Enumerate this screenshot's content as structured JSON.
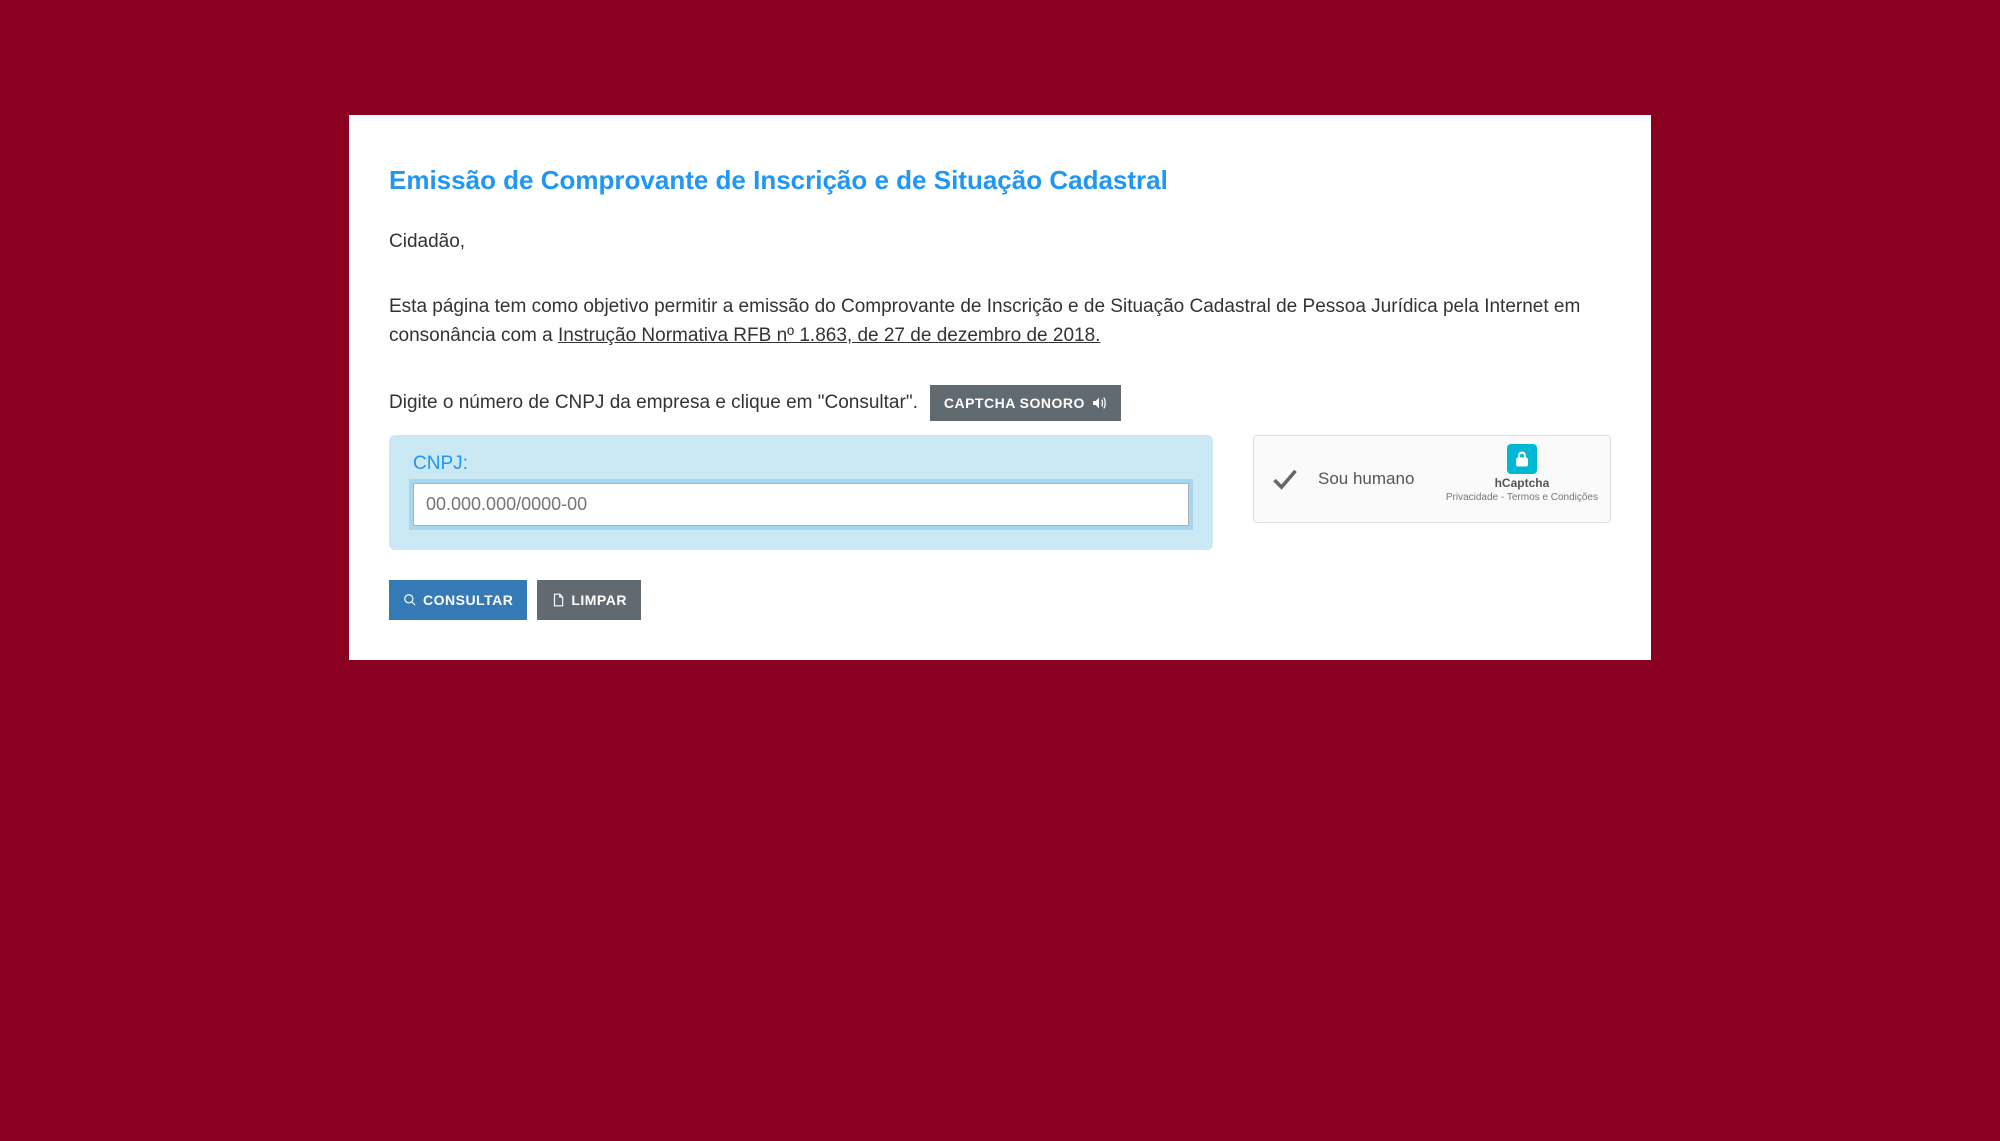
{
  "page": {
    "title": "Emissão de Comprovante de Inscrição e de Situação Cadastral",
    "greeting": "Cidadão,",
    "description_prefix": "Esta página tem como objetivo permitir a emissão do Comprovante de Inscrição e de Situação Cadastral de Pessoa Jurídica pela Internet em consonância com a ",
    "description_link": "Instrução Normativa RFB nº 1.863, de 27 de dezembro de 2018.",
    "instruction": "Digite o número de CNPJ da empresa e clique em \"Consultar\".",
    "captcha_sonoro_label": "CAPTCHA SONORO"
  },
  "form": {
    "cnpj_label": "CNPJ:",
    "cnpj_placeholder": "00.000.000/0000-00",
    "cnpj_value": ""
  },
  "hcaptcha": {
    "text": "Sou humano",
    "brand": "hCaptcha",
    "privacy": "Privacidade",
    "separator": " - ",
    "terms": "Termos e Condições",
    "checked": true
  },
  "buttons": {
    "consultar": "CONSULTAR",
    "limpar": "LIMPAR"
  }
}
